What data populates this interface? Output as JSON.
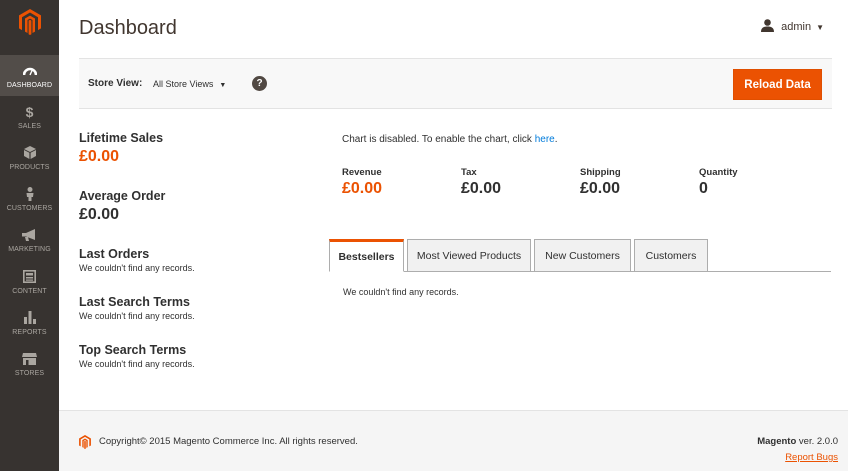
{
  "colors": {
    "accent": "#eb5202",
    "sidebar": "#373330",
    "link": "#007bdb"
  },
  "sidebar": {
    "logo_icon": "magento-logo-icon",
    "items": [
      {
        "label": "DASHBOARD",
        "icon": "dashboard-icon",
        "active": true
      },
      {
        "label": "SALES",
        "icon": "dollar-icon"
      },
      {
        "label": "PRODUCTS",
        "icon": "cube-icon"
      },
      {
        "label": "CUSTOMERS",
        "icon": "person-icon"
      },
      {
        "label": "MARKETING",
        "icon": "megaphone-icon"
      },
      {
        "label": "CONTENT",
        "icon": "layout-icon"
      },
      {
        "label": "REPORTS",
        "icon": "bar-chart-icon"
      },
      {
        "label": "STORES",
        "icon": "store-icon"
      }
    ]
  },
  "header": {
    "title": "Dashboard",
    "user": "admin"
  },
  "store_bar": {
    "label": "Store View:",
    "selected": "All Store Views",
    "help": "?",
    "reload_button": "Reload Data"
  },
  "left": {
    "lifetime_sales": {
      "title": "Lifetime Sales",
      "value": "£0.00"
    },
    "average_order": {
      "title": "Average Order",
      "value": "£0.00"
    },
    "last_orders": {
      "title": "Last Orders",
      "empty": "We couldn't find any records."
    },
    "last_search": {
      "title": "Last Search Terms",
      "empty": "We couldn't find any records."
    },
    "top_search": {
      "title": "Top Search Terms",
      "empty": "We couldn't find any records."
    }
  },
  "chart_notice": {
    "text": "Chart is disabled. To enable the chart, click ",
    "link": "here",
    "suffix": "."
  },
  "totals": [
    {
      "label": "Revenue",
      "value": "£0.00"
    },
    {
      "label": "Tax",
      "value": "£0.00"
    },
    {
      "label": "Shipping",
      "value": "£0.00"
    },
    {
      "label": "Quantity",
      "value": "0"
    }
  ],
  "tabs": [
    {
      "label": "Bestsellers",
      "active": true
    },
    {
      "label": "Most Viewed Products"
    },
    {
      "label": "New Customers"
    },
    {
      "label": "Customers"
    }
  ],
  "tab_content": {
    "empty": "We couldn't find any records."
  },
  "footer": {
    "copyright": "Copyright© 2015 Magento Commerce Inc. All rights reserved.",
    "brand": "Magento",
    "version": " ver. 2.0.0",
    "report_bugs": "Report Bugs"
  }
}
